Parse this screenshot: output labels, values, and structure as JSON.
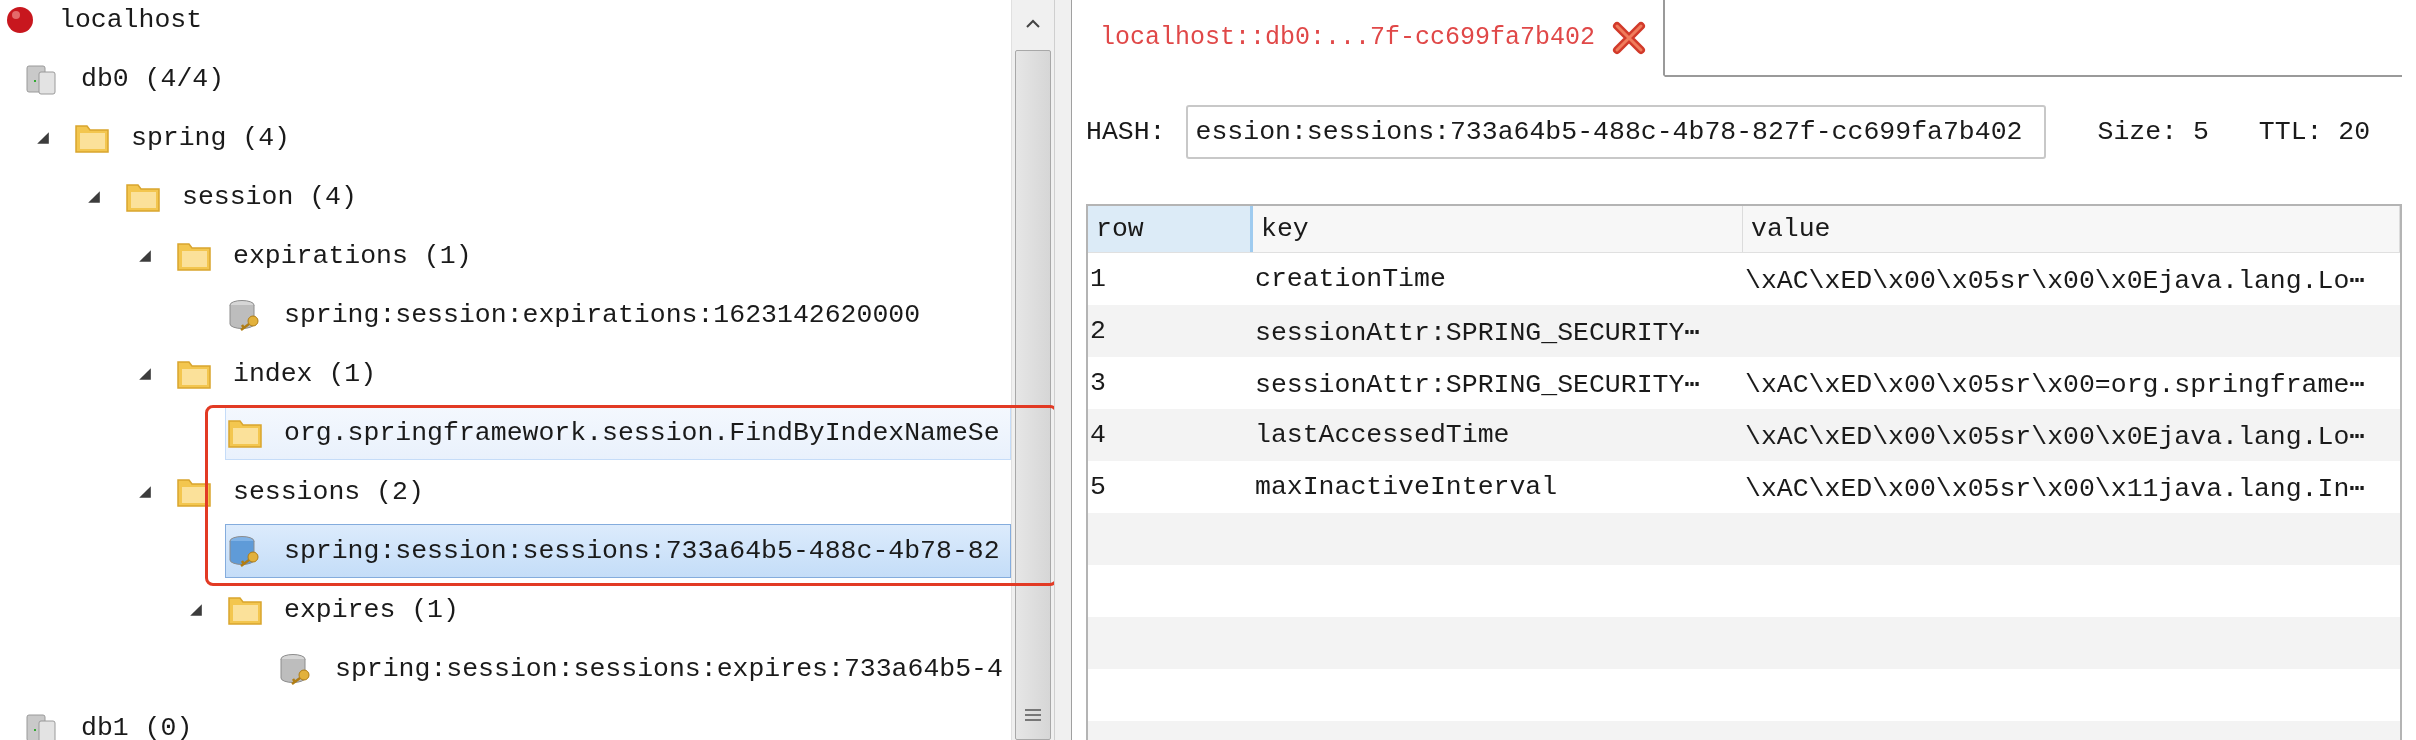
{
  "tree": [
    {
      "kind": "server",
      "label": "localhost",
      "selected": false,
      "hovered": false,
      "children": [
        {
          "kind": "db",
          "label": "db0 (4/4)",
          "selected": false,
          "hovered": false,
          "children": [
            {
              "kind": "folder",
              "label": "spring (4)",
              "expanded": true,
              "selected": false,
              "hovered": false,
              "children": [
                {
                  "kind": "folder",
                  "label": "session (4)",
                  "expanded": true,
                  "selected": false,
                  "hovered": false,
                  "children": [
                    {
                      "kind": "folder",
                      "label": "expirations (1)",
                      "expanded": true,
                      "selected": false,
                      "hovered": false,
                      "children": [
                        {
                          "kind": "key",
                          "label": "spring:session:expirations:1623142620000",
                          "selected": false,
                          "hovered": false
                        }
                      ]
                    },
                    {
                      "kind": "folder",
                      "label": "index (1)",
                      "expanded": true,
                      "selected": false,
                      "hovered": false,
                      "children": [
                        {
                          "kind": "folder",
                          "label": "org.springframework.session.FindByIndexNameSe",
                          "selected": false,
                          "hovered": true,
                          "marked": true
                        }
                      ]
                    },
                    {
                      "kind": "folder",
                      "label": "sessions (2)",
                      "expanded": true,
                      "selected": false,
                      "hovered": false,
                      "marked": true,
                      "children": [
                        {
                          "kind": "key",
                          "label": "spring:session:sessions:733a64b5-488c-4b78-82",
                          "selected": true,
                          "hovered": false,
                          "marked": true
                        },
                        {
                          "kind": "folder",
                          "label": "expires (1)",
                          "expanded": true,
                          "selected": false,
                          "hovered": false,
                          "children": [
                            {
                              "kind": "key",
                              "label": "spring:session:sessions:expires:733a64b5-4",
                              "selected": false,
                              "hovered": false
                            }
                          ]
                        }
                      ]
                    }
                  ]
                }
              ]
            }
          ]
        },
        {
          "kind": "db",
          "label": "db1 (0)",
          "selected": false,
          "hovered": false
        }
      ]
    }
  ],
  "tabs": [
    {
      "label": "localhost::db0:...7f-cc699fa7b402",
      "selected": true
    }
  ],
  "hash": {
    "label": "HASH:",
    "value": "ession:sessions:733a64b5-488c-4b78-827f-cc699fa7b402",
    "size": "Size: 5",
    "ttl": "TTL: 20"
  },
  "table": {
    "columns": [
      {
        "label": "row",
        "selected": true
      },
      {
        "label": "key",
        "selected": false
      },
      {
        "label": "value",
        "selected": false
      }
    ],
    "rows": [
      {
        "row": "1",
        "key": "creationTime",
        "value": "\\xAC\\xED\\x00\\x05sr\\x00\\x0Ejava.lang.Lo⋯"
      },
      {
        "row": "2",
        "key": "sessionAttr:SPRING_SECURITY⋯"
      },
      {
        "row": "3",
        "key": "sessionAttr:SPRING_SECURITY⋯",
        "value": "\\xAC\\xED\\x00\\x05sr\\x00=org.springframe⋯"
      },
      {
        "row": "4",
        "key": "lastAccessedTime",
        "value": "\\xAC\\xED\\x00\\x05sr\\x00\\x0Ejava.lang.Lo⋯"
      },
      {
        "row": "5",
        "key": "maxInactiveInterval",
        "value": "\\xAC\\xED\\x00\\x05sr\\x00\\x11java.lang.In⋯"
      }
    ]
  }
}
